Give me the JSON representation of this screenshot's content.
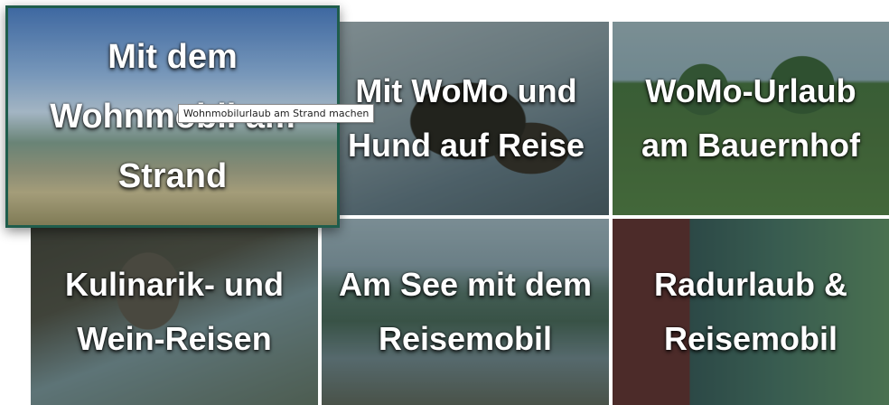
{
  "tiles": [
    {
      "label": "Mit WoMo und Hund auf Reise"
    },
    {
      "label": "WoMo-Urlaub am Bauernhof"
    },
    {
      "label": "Kulinarik- und Wein-Reisen"
    },
    {
      "label": "Am See mit dem Reisemobil"
    },
    {
      "label": "Radurlaub & Reisemobil"
    },
    {
      "label": "Mit dem Wohnmobil am Strand"
    }
  ],
  "tooltip": {
    "text": "Wohnmobilurlaub am Strand machen"
  },
  "colors": {
    "hover_border": "#1f5d4c",
    "overlay": "rgba(20,45,40,0.38)",
    "text": "#ffffff"
  }
}
